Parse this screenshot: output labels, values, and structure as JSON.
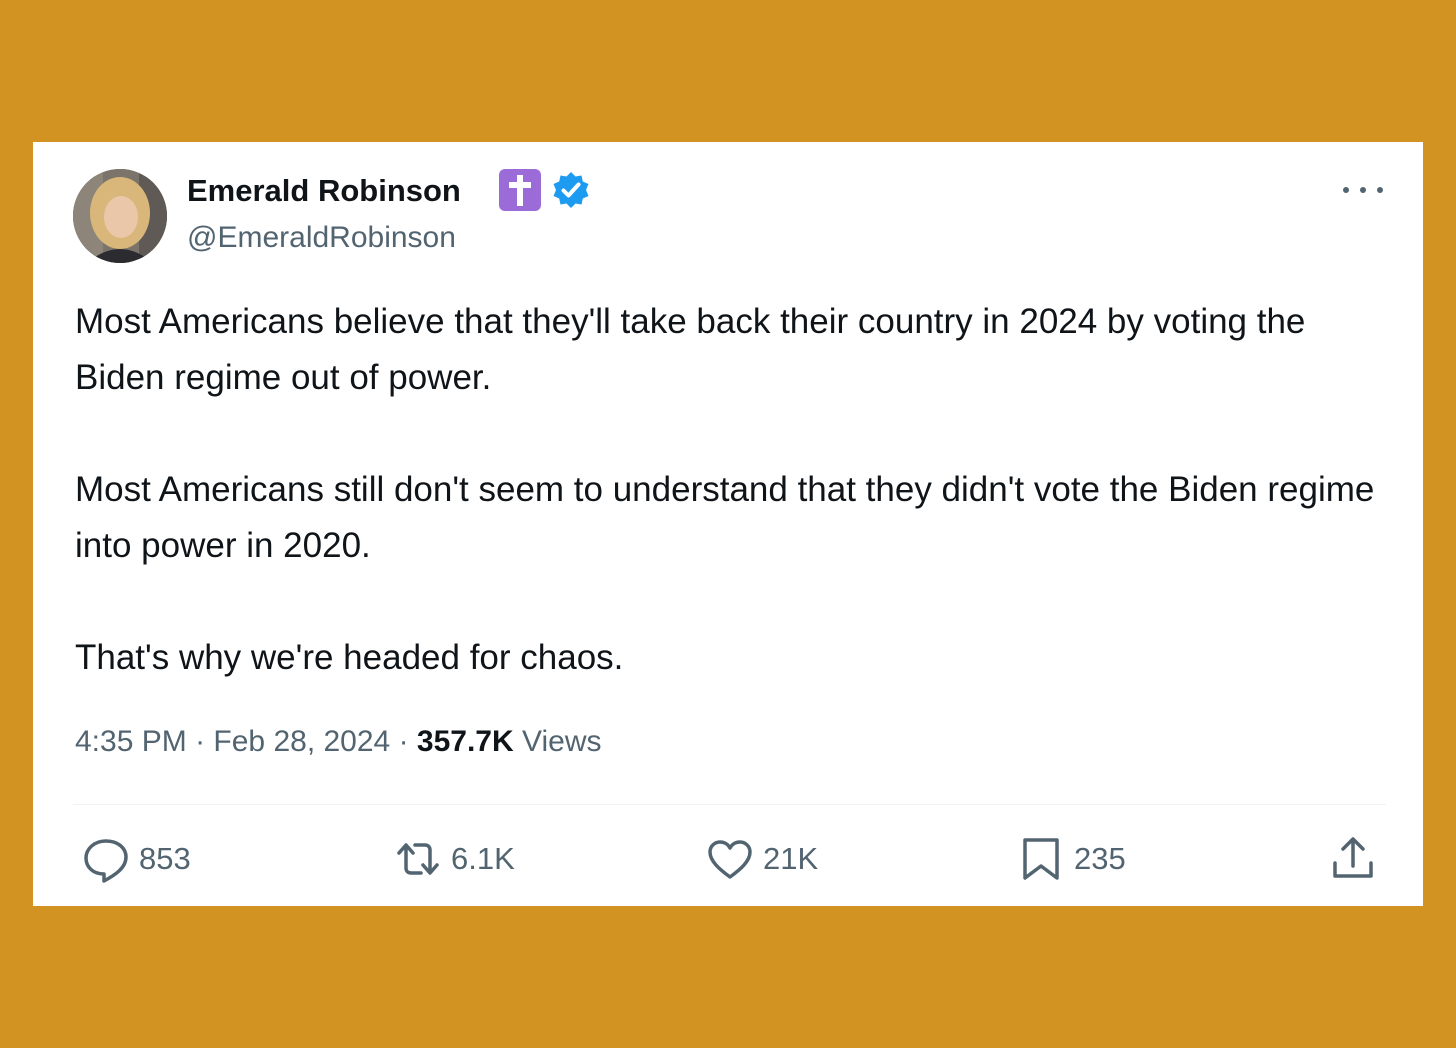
{
  "tweet": {
    "author": {
      "display_name": "Emerald Robinson",
      "handle": "@EmeraldRobinson",
      "badges": [
        "cross-emoji-icon",
        "verified-badge-icon"
      ]
    },
    "text": [
      "Most Americans believe that they'll take back their country in 2024 by voting the Biden regime out of power.",
      "Most Americans still don't seem to understand that they didn't vote the Biden regime into power in 2020.",
      "That's why we're headed for chaos."
    ],
    "meta": {
      "time": "4:35 PM",
      "separator": "·",
      "date": "Feb 28, 2024",
      "views_count": "357.7K",
      "views_label": "Views"
    },
    "actions": {
      "replies": "853",
      "reposts": "6.1K",
      "likes": "21K",
      "bookmarks": "235"
    }
  },
  "colors": {
    "page_background": "#D29322",
    "card_background": "#FFFFFF",
    "primary_text": "#0F1419",
    "secondary_text": "#536471",
    "verified_blue": "#1D9BF0",
    "cross_badge": "#9B6BD8"
  }
}
